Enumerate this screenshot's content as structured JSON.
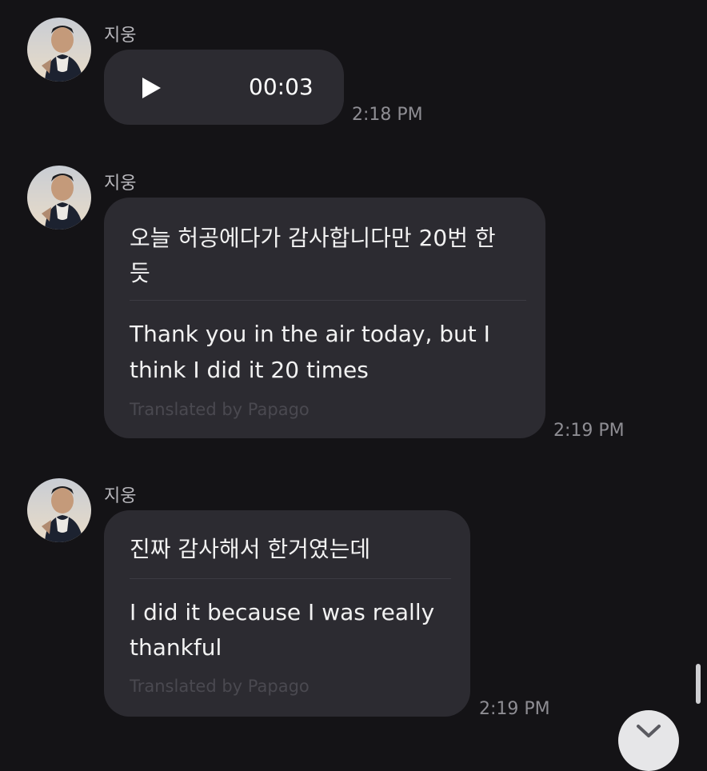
{
  "messages": [
    {
      "sender": "지웅",
      "type": "voice",
      "duration": "00:03",
      "time": "2:18 PM"
    },
    {
      "sender": "지웅",
      "type": "text",
      "original_lines": [
        "오늘 허공에다가 감사합니다만 20번 한",
        "듯"
      ],
      "translation_lines": [
        "Thank you in the air today, but I",
        "think I did it 20 times"
      ],
      "translated_by": "Translated by Papago",
      "time": "2:19 PM"
    },
    {
      "sender": "지웅",
      "type": "text",
      "original_lines": [
        "진짜 감사해서 한거였는데"
      ],
      "translation_lines": [
        "I did it because I was really",
        "thankful"
      ],
      "translated_by": "Translated by Papago",
      "time": "2:19 PM"
    }
  ],
  "icons": {
    "play": "play-icon",
    "avatar": "avatar",
    "scroll_down": "chevron-down-icon"
  },
  "colors": {
    "background": "#141316",
    "bubble": "#2c2b31",
    "text": "#f2f2f2",
    "secondary_text": "#8e8d93",
    "papago_text": "#4a4950"
  }
}
